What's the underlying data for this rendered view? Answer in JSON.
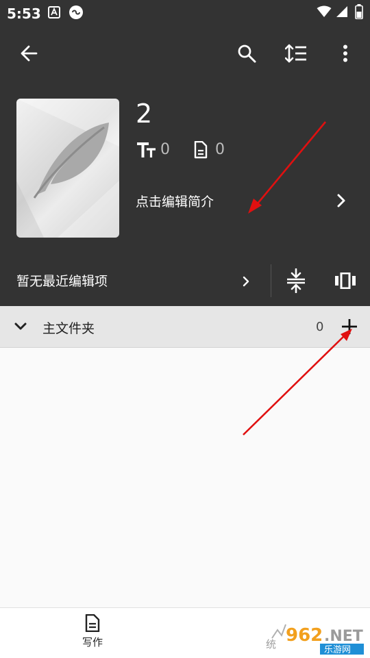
{
  "status_bar": {
    "time": "5:53"
  },
  "book": {
    "title": "2",
    "word_count": "0",
    "chapter_count": "0",
    "intro_placeholder": "点击编辑简介"
  },
  "recent": {
    "label": "暂无最近编辑项"
  },
  "folder": {
    "name": "主文件夹",
    "count": "0"
  },
  "bottom_nav": {
    "write_label": "写作",
    "stats_label": "统"
  },
  "watermark": {
    "text": "962.NET 乐游网"
  },
  "colors": {
    "header_bg": "#333333",
    "folder_bar_bg": "#e6e6e6",
    "annotation_arrow": "#e01010"
  }
}
